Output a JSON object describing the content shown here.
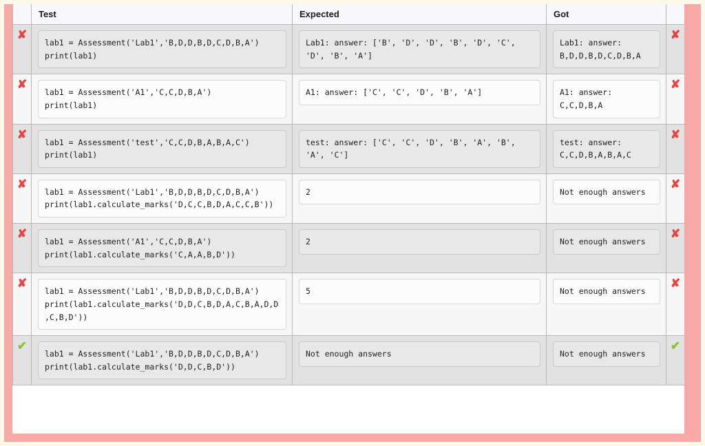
{
  "theme": {
    "outer_background": "#fdf8e8",
    "frame_color": "#f9a8a8",
    "fail_color": "#ef4040",
    "pass_color": "#86c232",
    "header_background": "#f8f8fc"
  },
  "table": {
    "columns": {
      "status_left": "",
      "test": "Test",
      "expected": "Expected",
      "got": "Got",
      "status_right": ""
    },
    "icons": {
      "fail": "cross-mark-icon",
      "pass": "check-mark-icon",
      "fail_glyph": "✘",
      "pass_glyph": "✔"
    },
    "rows": [
      {
        "status": "fail",
        "test": "lab1 = Assessment('Lab1','B,D,D,B,D,C,D,B,A')\nprint(lab1)",
        "expected": "Lab1: answer: ['B', 'D', 'D', 'B', 'D', 'C', 'D', 'B', 'A']",
        "got": "Lab1: answer: B,D,D,B,D,C,D,B,A"
      },
      {
        "status": "fail",
        "test": "lab1 = Assessment('A1','C,C,D,B,A')\nprint(lab1)",
        "expected": "A1: answer: ['C', 'C', 'D', 'B', 'A']",
        "got": "A1: answer: C,C,D,B,A"
      },
      {
        "status": "fail",
        "test": "lab1 = Assessment('test','C,C,D,B,A,B,A,C')\nprint(lab1)",
        "expected": "test: answer: ['C', 'C', 'D', 'B', 'A', 'B', 'A', 'C']",
        "got": "test: answer: C,C,D,B,A,B,A,C"
      },
      {
        "status": "fail",
        "test": "lab1 = Assessment('Lab1','B,D,D,B,D,C,D,B,A')\nprint(lab1.calculate_marks('D,C,C,B,D,A,C,C,B'))",
        "expected": "2",
        "got": "Not enough answers"
      },
      {
        "status": "fail",
        "test": "lab1 = Assessment('A1','C,C,D,B,A')\nprint(lab1.calculate_marks('C,A,A,B,D'))",
        "expected": "2",
        "got": "Not enough answers"
      },
      {
        "status": "fail",
        "test": "lab1 = Assessment('Lab1','B,D,D,B,D,C,D,B,A')\nprint(lab1.calculate_marks('D,D,C,B,D,A,C,B,A,D,D,C,B,D'))",
        "expected": "5",
        "got": "Not enough answers"
      },
      {
        "status": "pass",
        "test": "lab1 = Assessment('Lab1','B,D,D,B,D,C,D,B,A')\nprint(lab1.calculate_marks('D,D,C,B,D'))",
        "expected": "Not enough answers",
        "got": "Not enough answers"
      }
    ]
  }
}
